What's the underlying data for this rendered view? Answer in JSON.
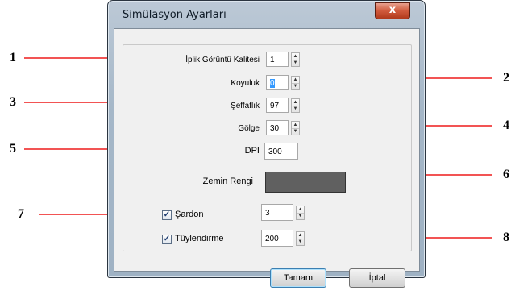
{
  "dialog": {
    "title": "Simülasyon Ayarları",
    "close_glyph": "x"
  },
  "fields": [
    {
      "label": "İplik Görüntü Kalitesi",
      "value": "1"
    },
    {
      "label": "Koyuluk",
      "value": "0"
    },
    {
      "label": "Şeffaflık",
      "value": "97"
    },
    {
      "label": "Gölge",
      "value": "30"
    },
    {
      "label": "DPI",
      "value": "300"
    }
  ],
  "background_color": {
    "label": "Zemin Rengi",
    "color": "#606060"
  },
  "options": [
    {
      "label": "Şardon",
      "checked": true,
      "value": "3"
    },
    {
      "label": "Tüylendirme",
      "checked": true,
      "value": "200"
    }
  ],
  "buttons": {
    "ok": "Tamam",
    "cancel": "İptal"
  },
  "annotations": [
    "1",
    "2",
    "3",
    "4",
    "5",
    "6",
    "7",
    "8"
  ],
  "colors": {
    "arrow": "#ee1c1c"
  },
  "icons": {
    "checked": "check-icon",
    "spin_up": "up-arrow-icon",
    "spin_down": "down-arrow-icon"
  }
}
